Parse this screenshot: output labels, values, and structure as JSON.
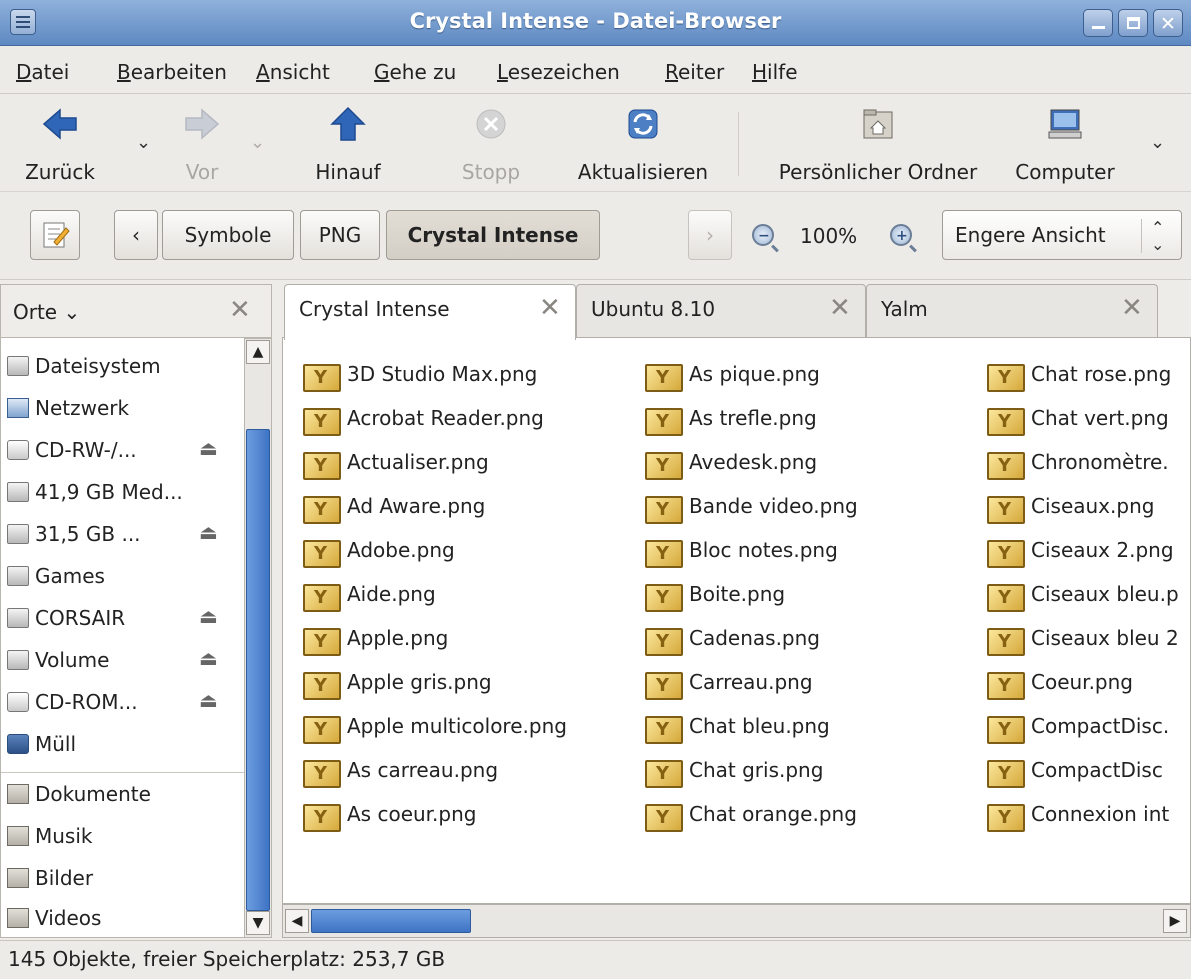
{
  "window": {
    "title": "Crystal Intense - Datei-Browser"
  },
  "menu": [
    "Datei",
    "Bearbeiten",
    "Ansicht",
    "Gehe zu",
    "Lesezeichen",
    "Reiter",
    "Hilfe"
  ],
  "toolbar": {
    "back": "Zurück",
    "forward": "Vor",
    "up": "Hinauf",
    "stop": "Stopp",
    "reload": "Aktualisieren",
    "home": "Persönlicher Ordner",
    "computer": "Computer"
  },
  "location": {
    "crumbs": [
      "Symbole",
      "PNG",
      "Crystal Intense"
    ],
    "zoom": "100%",
    "view": "Engere Ansicht"
  },
  "sidebar": {
    "title": "Orte",
    "items": [
      {
        "label": "Dateisystem",
        "icon": "drive-icon"
      },
      {
        "label": "Netzwerk",
        "icon": "network-icon"
      },
      {
        "label": "CD-RW-/...",
        "icon": "cd-icon"
      },
      {
        "label": "41,9 GB Med...",
        "icon": "drive-icon"
      },
      {
        "label": "31,5 GB ...",
        "icon": "drive-icon"
      },
      {
        "label": "Games",
        "icon": "drive-icon"
      },
      {
        "label": "CORSAIR",
        "icon": "drive-icon"
      },
      {
        "label": "Volume",
        "icon": "drive-icon"
      },
      {
        "label": "CD-ROM...",
        "icon": "cd-icon"
      },
      {
        "label": "Müll",
        "icon": "trash-icon"
      },
      {
        "label": "Dokumente",
        "icon": "folder-icon"
      },
      {
        "label": "Musik",
        "icon": "folder-icon"
      },
      {
        "label": "Bilder",
        "icon": "folder-icon"
      },
      {
        "label": "Videos",
        "icon": "folder-icon"
      }
    ]
  },
  "tabs": [
    "Crystal Intense",
    "Ubuntu 8.10",
    "Yalm"
  ],
  "files": {
    "col1": [
      "3D Studio Max.png",
      "Acrobat Reader.png",
      "Actualiser.png",
      "Ad Aware.png",
      "Adobe.png",
      "Aide.png",
      "Apple.png",
      "Apple gris.png",
      "Apple multicolore.png",
      "As carreau.png",
      "As coeur.png"
    ],
    "col2": [
      "As pique.png",
      "As trefle.png",
      "Avedesk.png",
      "Bande video.png",
      "Bloc notes.png",
      "Boite.png",
      "Cadenas.png",
      "Carreau.png",
      "Chat bleu.png",
      "Chat gris.png",
      "Chat orange.png"
    ],
    "col3": [
      "Chat rose.png",
      "Chat vert.png",
      "Chronomètre.",
      "Ciseaux.png",
      "Ciseaux 2.png",
      "Ciseaux bleu.p",
      "Ciseaux bleu 2",
      "Coeur.png",
      "CompactDisc.",
      "CompactDisc",
      "Connexion int"
    ]
  },
  "status": "145 Objekte, freier Speicherplatz: 253,7 GB",
  "colors": {
    "titlebar": "#6f96cb",
    "scroll_thumb": "#4f83cf"
  }
}
